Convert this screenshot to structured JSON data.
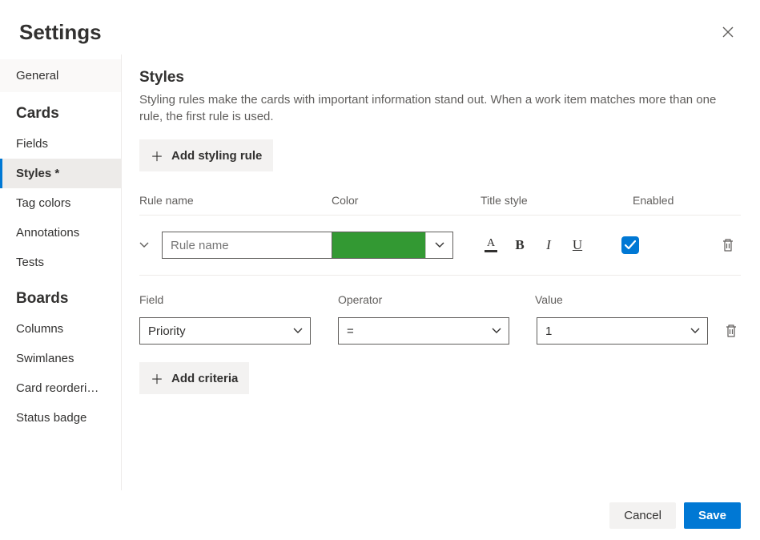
{
  "header": {
    "title": "Settings"
  },
  "sidebar": {
    "general_label": "General",
    "cards_header": "Cards",
    "cards_items": [
      "Fields",
      "Styles *",
      "Tag colors",
      "Annotations",
      "Tests"
    ],
    "active_cards_index": 1,
    "boards_header": "Boards",
    "boards_items": [
      "Columns",
      "Swimlanes",
      "Card reorderi…",
      "Status badge"
    ]
  },
  "main": {
    "title": "Styles",
    "description": "Styling rules make the cards with important information stand out. When a work item matches more than one rule, the first rule is used.",
    "add_rule_label": "Add styling rule",
    "columns": {
      "rulename": "Rule name",
      "color": "Color",
      "titlestyle": "Title style",
      "enabled": "Enabled"
    },
    "rule": {
      "name_placeholder": "Rule name",
      "name_value": "",
      "color": "#339933",
      "enabled": true
    },
    "criteria": {
      "columns": {
        "field": "Field",
        "operator": "Operator",
        "value": "Value"
      },
      "row": {
        "field": "Priority",
        "operator": "=",
        "value": "1"
      },
      "add_label": "Add criteria"
    }
  },
  "footer": {
    "cancel": "Cancel",
    "save": "Save"
  }
}
